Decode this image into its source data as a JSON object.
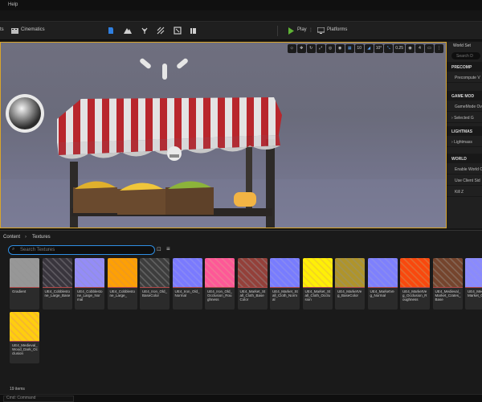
{
  "menubar": {
    "help_label": "Help"
  },
  "toolbar": {
    "fragment_label": "ts",
    "cinematics_label": "Cinematics",
    "play_label": "Play",
    "platforms_label": "Platforms",
    "play_color": "#5fb336"
  },
  "viewport_toolbar": {
    "grid_snap": "10",
    "rotation_snap": "10°",
    "scale_snap": "0.25",
    "camera_speed": "4"
  },
  "details": {
    "tab_label": "World Set",
    "search_placeholder": "Search D",
    "sections": [
      {
        "title": "PRECOMP",
        "rows": [
          "Precompute V"
        ]
      },
      {
        "title": "GAME MOD",
        "rows": [
          "GameMode Ov",
          "Selected G"
        ]
      },
      {
        "title": "LIGHTMAS",
        "rows": [
          "Lightmass"
        ]
      },
      {
        "title": "WORLD",
        "rows": [
          "Enable World C",
          "Use Client Sid",
          "Kill Z"
        ]
      }
    ]
  },
  "content_browser": {
    "breadcrumb": [
      "Content",
      "Textures"
    ],
    "search_placeholder": "Search Textures",
    "item_count": "19 items",
    "items": [
      {
        "label": "Gradient",
        "color": "#8c8c8c"
      },
      {
        "label": "UE4_Cobblestone_Large_Base",
        "color": "#555258"
      },
      {
        "label": "UE4_Cobblestone_Large_Normal",
        "color": "#8a86e0"
      },
      {
        "label": "UE4_Cobblestone_Large_",
        "color": "#f0911a"
      },
      {
        "label": "UE4_Iron_Old_BaseColor",
        "color": "#585858"
      },
      {
        "label": "UE4_Iron_Old_Normal",
        "color": "#7d7df5"
      },
      {
        "label": "UE4_Iron_Old_Occlusion_Roughness",
        "color": "#f26a8c"
      },
      {
        "label": "UE4_Market_Stall_Cloth_BaseColor",
        "color": "#8a5a56"
      },
      {
        "label": "UE4_Market_Stall_Cloth_Normal",
        "color": "#7c7ef2"
      },
      {
        "label": "UE4_Market_Stall_Cloth_Occlusion",
        "color": "#f2d21e"
      },
      {
        "label": "UE4_MarketVeg_BaseColor",
        "color": "#9a8a4a"
      },
      {
        "label": "UE4_MarketVeg_Normal",
        "color": "#7f80f0"
      },
      {
        "label": "UE4_MarketVeg_Occlusion_Roughness",
        "color": "#e4602a"
      },
      {
        "label": "UE4_Medieval_Market_Crates_Base",
        "color": "#7a5d4c"
      },
      {
        "label": "UE4_Medieval_Market_Crates_",
        "color": "#8585f0"
      },
      {
        "label": "UE4_Medieval_Wood_Dark_Occlusion",
        "color": "#f4b02c"
      }
    ]
  },
  "command": {
    "placeholder": "Cmd: Command"
  }
}
